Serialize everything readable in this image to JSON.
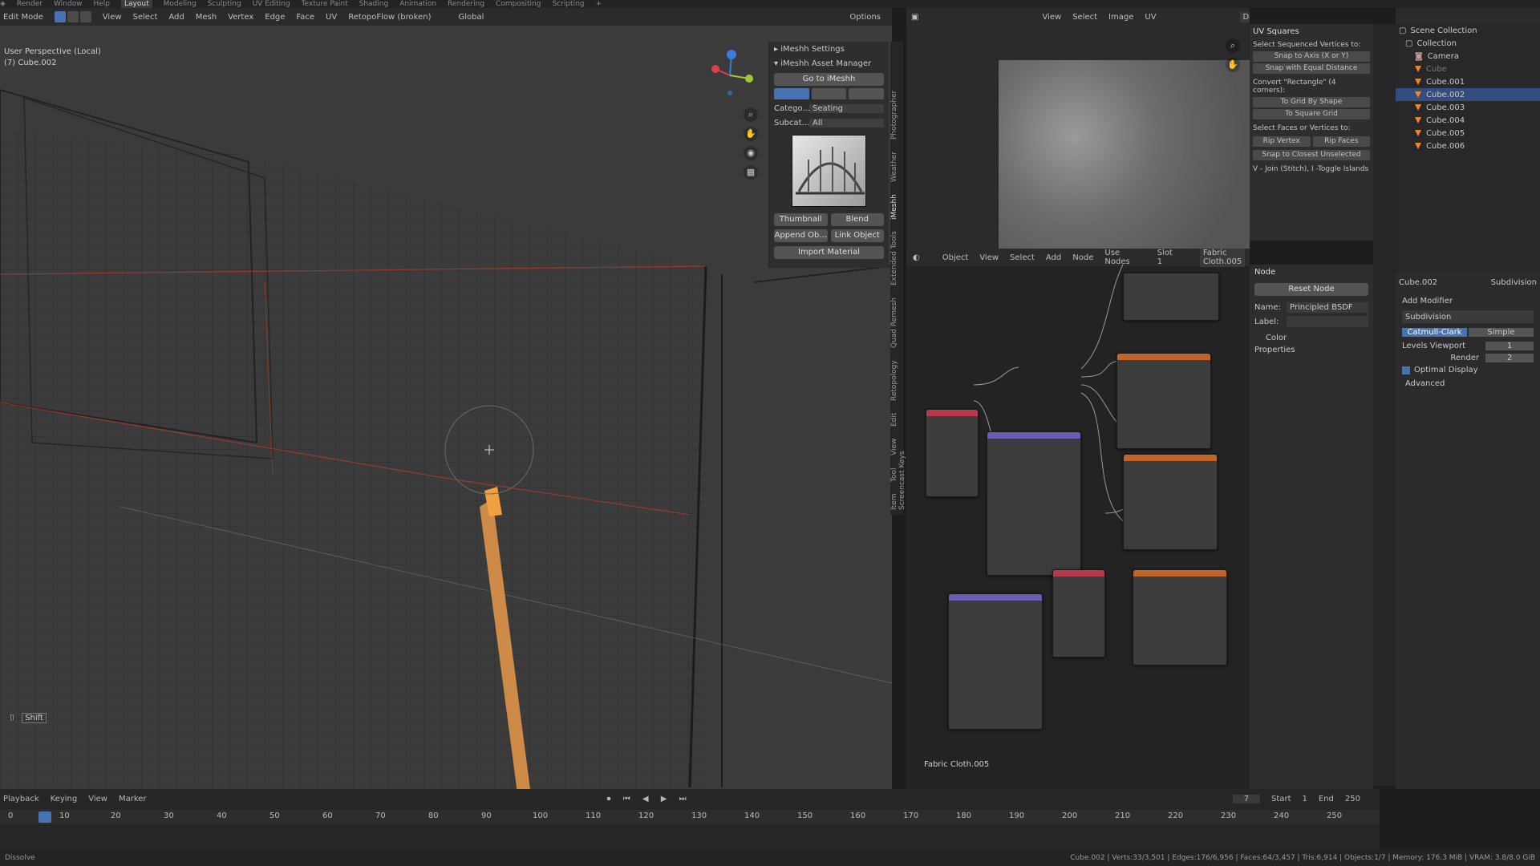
{
  "topbar": {
    "menus": [
      "Render",
      "Window",
      "Help"
    ],
    "workspaces": [
      "Layout",
      "Modeling",
      "Sculpting",
      "UV Editing",
      "Texture Paint",
      "Shading",
      "Animation",
      "Rendering",
      "Compositing",
      "Scripting"
    ],
    "active_workspace": "Layout"
  },
  "viewport": {
    "mode": "Edit Mode",
    "menus": [
      "View",
      "Select",
      "Add",
      "Mesh",
      "Vertex",
      "Edge",
      "Face",
      "UV"
    ],
    "retopo": "RetopoFlow (broken)",
    "transform": "Global",
    "options": "Options",
    "info_line1": "User Perspective (Local)",
    "info_line2": "(7) Cube.002",
    "shift_label": "Shift"
  },
  "npanel": {
    "imeshh_settings": "iMeshh Settings",
    "asset_manager": "iMeshh Asset Manager",
    "go_to": "Go to iMeshh",
    "category_label": "Catego...",
    "category_value": "Seating",
    "subcat_label": "Subcat...",
    "subcat_value": "All",
    "thumbnail": "Thumbnail",
    "blend": "Blend",
    "append": "Append Ob...",
    "link": "Link Object",
    "import": "Import Material"
  },
  "viewport_tabs": [
    "Item",
    "Tool",
    "View",
    "Edit",
    "Retopology",
    "Quad Remesh",
    "Extended Tools",
    "iMeshh",
    "Weather",
    "Photographer",
    "Screencast Keys"
  ],
  "uv_editor": {
    "menus": [
      "View",
      "Select",
      "Image",
      "UV"
    ],
    "image_name": "DefaultFabricMask..."
  },
  "uv_squares": {
    "title": "UV Squares",
    "sel_seq": "Select Sequenced Vertices to:",
    "snap_axis": "Snap to Axis (X or Y)",
    "snap_equal": "Snap with Equal Distance",
    "convert": "Convert \"Rectangle\" (4 corners):",
    "to_grid": "To Grid By Shape",
    "to_square": "To Square Grid",
    "sel_faces": "Select Faces or Vertices to:",
    "rip_vertex": "Rip Vertex",
    "rip_faces": "Rip Faces",
    "snap_closest": "Snap to Closest Unselected",
    "join": "V - Join (Stitch), I -Toggle Islands"
  },
  "outliner": {
    "root": "Scene Collection",
    "collection": "Collection",
    "items": [
      "Camera",
      "Cube",
      "Cube.001",
      "Cube.002",
      "Cube.003",
      "Cube.004",
      "Cube.005",
      "Cube.006"
    ],
    "selected": "Cube.002"
  },
  "node_editor": {
    "type": "Object",
    "menus": [
      "View",
      "Select",
      "Add",
      "Node"
    ],
    "use_nodes": "Use Nodes",
    "slot": "Slot 1",
    "material": "Fabric Cloth.005",
    "footer_label": "Fabric Cloth.005"
  },
  "node_sidebar": {
    "title": "Node",
    "reset": "Reset Node",
    "name_label": "Name:",
    "name_value": "Principled BSDF",
    "label_label": "Label:",
    "color": "Color",
    "properties": "Properties"
  },
  "properties": {
    "object": "Cube.002",
    "modifier_tab": "Subdivision",
    "add_modifier": "Add Modifier",
    "modifier_name": "Subdivision",
    "catmull": "Catmull-Clark",
    "simple": "Simple",
    "levels_label": "Levels Viewport",
    "levels_value": "1",
    "render_label": "Render",
    "render_value": "2",
    "optimal": "Optimal Display",
    "advanced": "Advanced"
  },
  "timeline": {
    "playback": "Playback",
    "keying": "Keying",
    "view": "View",
    "marker": "Marker",
    "current_frame": "7",
    "start_label": "Start",
    "start_value": "1",
    "end_label": "End",
    "end_value": "250",
    "ticks": [
      "0",
      "10",
      "20",
      "30",
      "40",
      "50",
      "60",
      "70",
      "80",
      "90",
      "100",
      "110",
      "120",
      "130",
      "140",
      "150",
      "160",
      "170",
      "180",
      "190",
      "200",
      "210",
      "220",
      "230",
      "240",
      "250"
    ]
  },
  "status": {
    "left": "Dissolve",
    "stats": "Cube.002 | Verts:33/3,501 | Edges:176/6,956 | Faces:64/3,457 | Tris:6,914 | Objects:1/7 | Memory: 176.3 MiB | VRAM: 3.8/8.0 GiB"
  },
  "colors": {
    "accent": "#4772b3",
    "orange": "#e38b2a",
    "selection": "#334d80"
  }
}
